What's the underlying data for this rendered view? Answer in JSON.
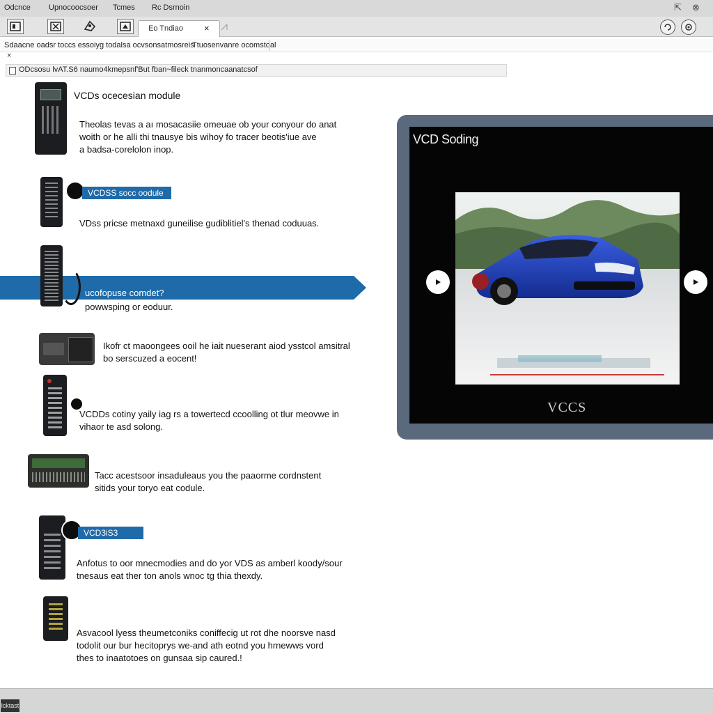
{
  "menu": {
    "items": [
      "Odcnce",
      "Upnocoocsoer",
      "Tcmes",
      "Rc Dsrnoin"
    ]
  },
  "window_controls": {
    "pin": "⇱",
    "close": "⊗"
  },
  "tab": {
    "label": "Eo Tndiao",
    "close": "×"
  },
  "subbar": {
    "left": "Sdaacne oadsr toccs essoiyg todalsa ocvsonsatmosreis",
    "right": "Ttuosenvanre ocomstoal"
  },
  "x_mark": "×",
  "address": {
    "text": "ODcsosu lvAT.S6 naumo4kmepsnf'But fban~fileck tnanmoncaanatcsof"
  },
  "modules": [
    {
      "title": "VCDs ocecesian module",
      "lines": [
        "Theolas tevas a aı mosacasiie omeuae ob your conyour do anat",
        "woith or he alli thi tnausye bis wihoy fo tracer beotis'iue ave",
        "a badsa-corelolon inop."
      ]
    },
    {
      "label": "VCDSS socc oodule",
      "lines": [
        "VDss pricse metnaxd guneilise gudiblitiel's thenad coduuas."
      ]
    },
    {
      "lines": [
        "ucofopuse comdet?",
        "powwsping or eoduur."
      ]
    },
    {
      "lines": [
        "Ikofr ct maoongees ooil he iait nueserant aiod ysstcol amsitral",
        "bo serscuzed a eocent!"
      ]
    },
    {
      "lines": [
        "VCDDs cotiny yaily iag rs a towertecd ccoolling ot tlur meovwe in",
        "vihaor te asd solong."
      ]
    },
    {
      "lines": [
        "Tacc acestsoor insaduleaus you the paaorme cordnstent",
        "sitids your toryo eat codule."
      ]
    },
    {
      "label": "VCD3iS3",
      "lines": [
        "Anfotus to oor mnecmodies and do yor VDS as amberl koody/sour",
        "tnesaus eat ther ton anols wnoc tg thia thexdy."
      ]
    },
    {
      "lines": [
        "Asvacool lyess theumetconiks coniffecig ut rot dhe noorsve nasd",
        "todolit our bur hecitoprys we-and ath eotnd you hrnewws vord",
        "thes to inaatotoes on gunsaa sip caured.!"
      ]
    }
  ],
  "preview": {
    "title": "VCD Soding",
    "logo": "VCCS",
    "prev_arrow": "‹",
    "next_arrow": "›"
  },
  "status": {
    "button": "lcktast"
  },
  "colors": {
    "accent": "#1f6aa8",
    "monitor_bezel": "#5a6a7c",
    "car": "#1f3fb8"
  }
}
